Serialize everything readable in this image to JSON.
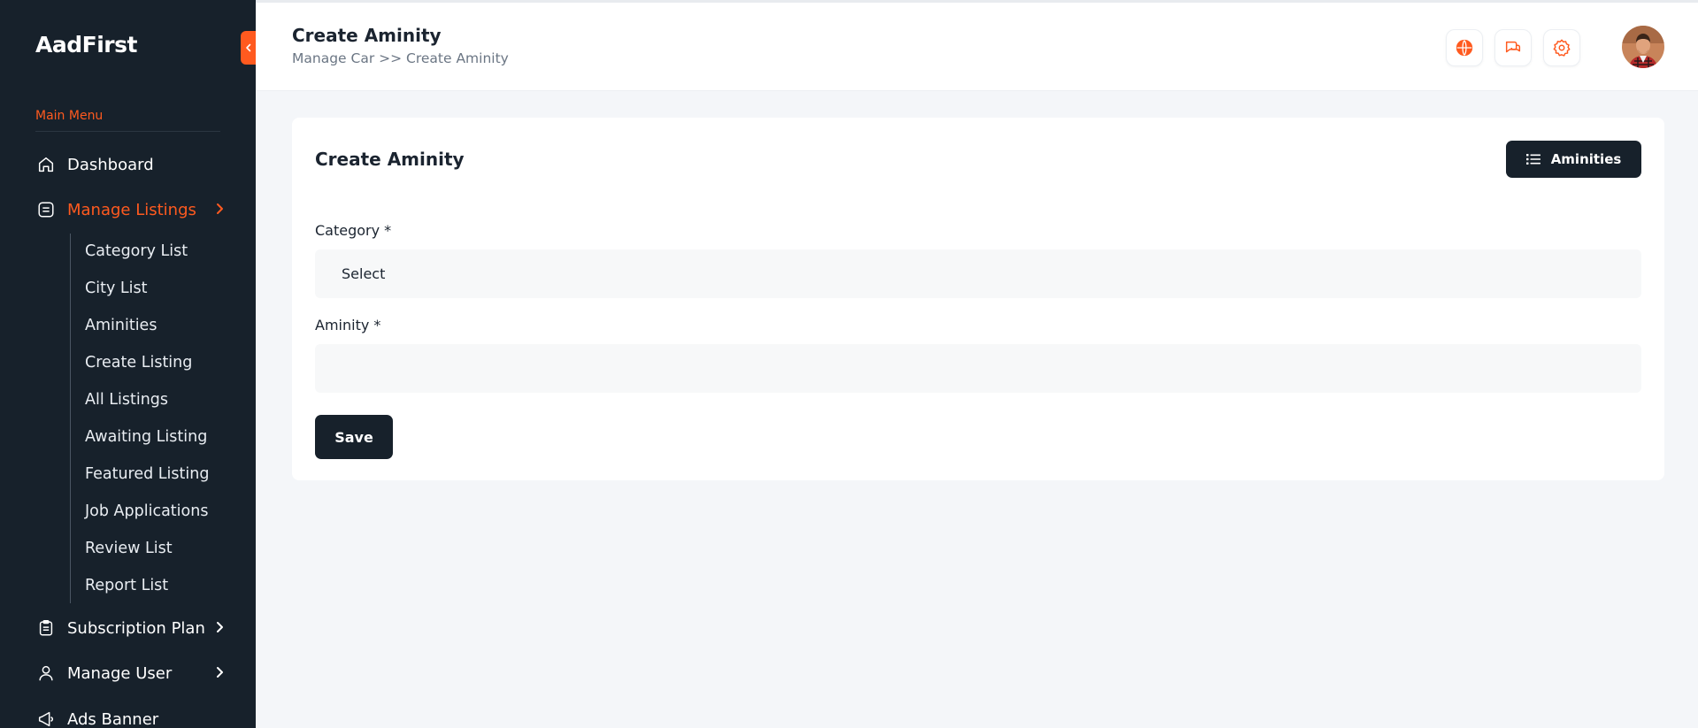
{
  "app": {
    "brand": "AadFirst"
  },
  "sidebar": {
    "menu_title": "Main Menu",
    "dashboard": "Dashboard",
    "manage_listings": "Manage Listings",
    "sub_items": [
      "Category List",
      "City List",
      "Aminities",
      "Create Listing",
      "All Listings",
      "Awaiting Listing",
      "Featured Listing",
      "Job Applications",
      "Review List",
      "Report List"
    ],
    "subscription_plan": "Subscription Plan",
    "manage_user": "Manage User",
    "ads_banner": "Ads Banner"
  },
  "header": {
    "title": "Create Aminity",
    "breadcrumb": "Manage Car >> Create Aminity"
  },
  "card": {
    "title": "Create Aminity",
    "list_button": "Aminities",
    "category_label": "Category *",
    "category_value": "Select",
    "aminity_label": "Aminity *",
    "aminity_value": "",
    "save_button": "Save"
  },
  "colors": {
    "sidebar_bg": "#17212b",
    "accent": "#ff5a1f",
    "page_bg": "#f4f6f9"
  },
  "icons": [
    "chevron-left-icon",
    "home-icon",
    "list-icon",
    "chevron-right-icon",
    "clipboard-icon",
    "user-icon",
    "megaphone-icon",
    "globe-icon",
    "chat-icon",
    "gear-icon"
  ]
}
